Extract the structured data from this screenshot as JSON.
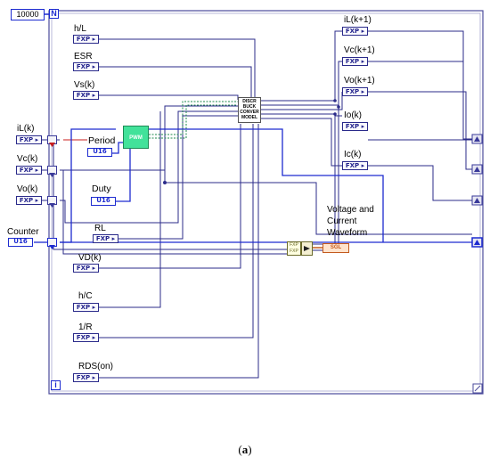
{
  "loop": {
    "count": "10000",
    "count_terminal": "N",
    "iteration_terminal": "i"
  },
  "inputs_top": [
    {
      "name": "h/L",
      "type": "FXP"
    },
    {
      "name": "ESR",
      "type": "FXP"
    },
    {
      "name": "Vs(k)",
      "type": "FXP"
    }
  ],
  "state_inputs": [
    {
      "name": "iL(k)",
      "type": "FXP"
    },
    {
      "name": "Vc(k)",
      "type": "FXP"
    },
    {
      "name": "Vo(k)",
      "type": "FXP"
    }
  ],
  "counter": {
    "name": "Counter",
    "type": "U16"
  },
  "pwm": {
    "label": "PWM",
    "period_label": "Period",
    "period_type": "U16",
    "duty_label": "Duty",
    "duty_type": "U16"
  },
  "model": {
    "lines": [
      "DISCR",
      "BUCK",
      "CONVER",
      "MODEL"
    ]
  },
  "inputs_bottom": [
    {
      "name": "RL",
      "type": "FXP"
    },
    {
      "name": "VD(k)",
      "type": "FXP"
    },
    {
      "name": "h/C",
      "type": "FXP"
    },
    {
      "name": "1/R",
      "type": "FXP"
    },
    {
      "name": "RDS(on)",
      "type": "FXP"
    }
  ],
  "outputs": [
    {
      "name": "iL(k+1)",
      "type": "FXP"
    },
    {
      "name": "Vc(k+1)",
      "type": "FXP"
    },
    {
      "name": "Vo(k+1)",
      "type": "FXP"
    },
    {
      "name": "Io(k)",
      "type": "FXP"
    },
    {
      "name": "Ic(k)",
      "type": "FXP"
    }
  ],
  "waveform": {
    "label_lines": [
      "Voltage and",
      "Current",
      "Waveform"
    ],
    "bundle_text": [
      "FXP",
      "FXP"
    ],
    "indicator": "SGL"
  },
  "caption": {
    "open": "(",
    "letter": "a",
    "close": ")"
  },
  "colors": {
    "wire_fxp": "#2b2b8a",
    "wire_int": "#1d2bd0",
    "wire_bool": "#1f8a4c",
    "pwm_fill": "#42e29a",
    "waveform": "#c35a1e"
  }
}
